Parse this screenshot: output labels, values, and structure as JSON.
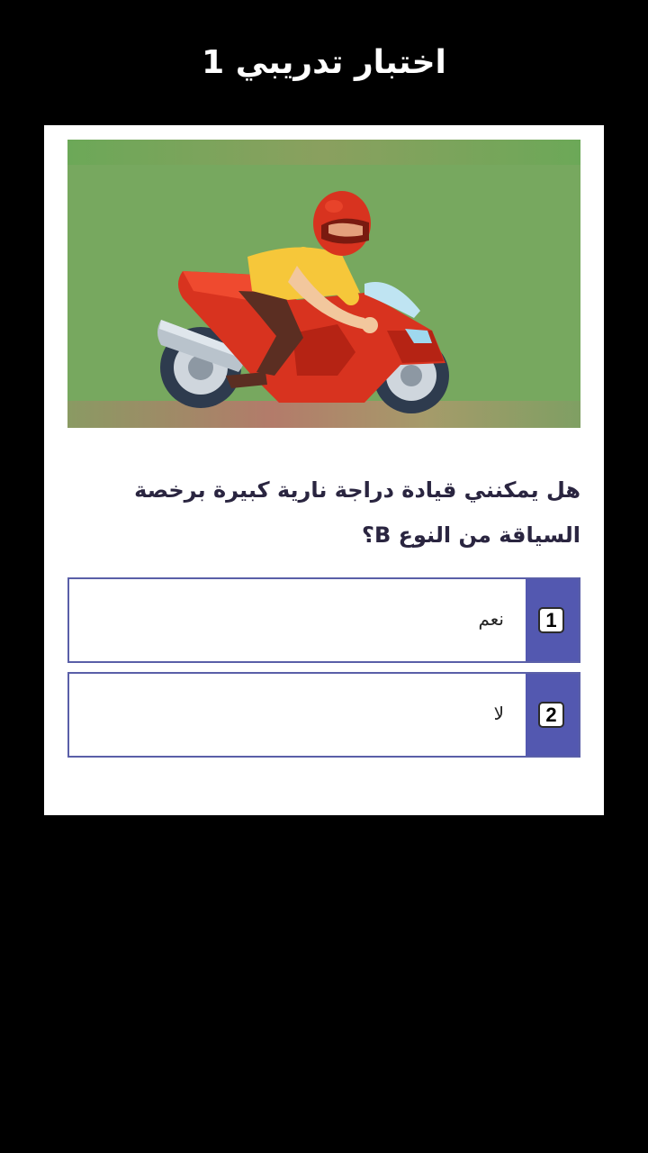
{
  "header": {
    "title": "اختبار تدريبي 1"
  },
  "question": {
    "text": "هل يمكنني قيادة دراجة نارية كبيرة برخصة السياقة من النوع B؟",
    "image_icon": "motorcycle-rider-illustration"
  },
  "answers": [
    {
      "number": "1",
      "label": "نعم"
    },
    {
      "number": "2",
      "label": "لا"
    }
  ],
  "colors": {
    "background": "#000000",
    "card": "#ffffff",
    "answer_accent": "#5358b0",
    "answer_border": "#5a5fa8",
    "illustration_bg": "#77a85f"
  }
}
